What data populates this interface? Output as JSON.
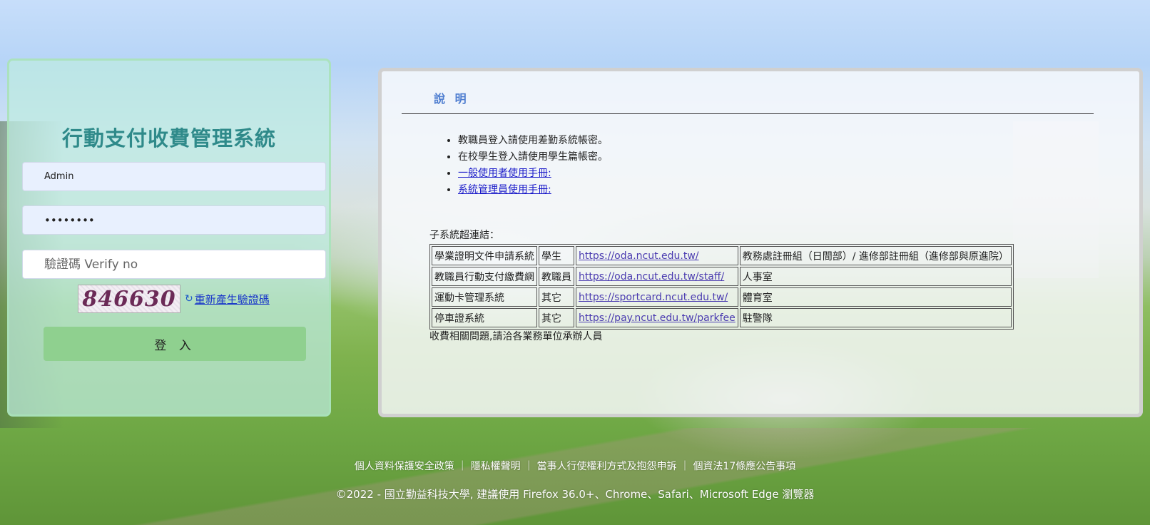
{
  "login": {
    "title": "行動支付收費管理系統",
    "username_value": "Admin",
    "password_value": "12345678",
    "captcha_placeholder": "驗證碼 Verify no",
    "captcha_code": "846630",
    "refresh_label": "重新產生驗證碼",
    "login_label": "登 入"
  },
  "info": {
    "title": "說 明",
    "notes": [
      "教職員登入請使用差勤系統帳密。",
      "在校學生登入請使用學生篇帳密。"
    ],
    "manual_links": [
      "一般使用者使用手冊:",
      "系統管理員使用手冊:"
    ],
    "subsystem_label": "子系統超連結：",
    "table": [
      [
        "學業證明文件申請系統",
        "學生",
        "https://oda.ncut.edu.tw/",
        "教務處註冊組（日間部）/ 進修部註冊組（進修部與原進院）"
      ],
      [
        "教職員行動支付繳費網",
        "教職員",
        "https://oda.ncut.edu.tw/staff/",
        "人事室"
      ],
      [
        "運動卡管理系統",
        "其它",
        "https://sportcard.ncut.edu.tw/",
        "體育室"
      ],
      [
        "停車證系統",
        "其它",
        "https://pay.ncut.edu.tw/parkfee",
        "駐警隊"
      ]
    ],
    "fee_note": "收費相關問題,請洽各業務單位承辦人員"
  },
  "footer": {
    "links": [
      "個人資料保護安全政策",
      "隱私權聲明",
      "當事人行使權利方式及抱怨申訴",
      "個資法17條應公告事項"
    ],
    "separator": "｜",
    "copyright": "©2022 - 國立勤益科技大學, 建議使用 Firefox 36.0+、Chrome、Safari、Microsoft Edge 瀏覽器"
  },
  "colors": {
    "title_teal": "#2f8a8a",
    "button_green": "#8fd08f",
    "link_blue": "#1a37c9",
    "info_title_blue": "#4f7ed0"
  },
  "icons": {
    "refresh": "refresh-icon"
  }
}
